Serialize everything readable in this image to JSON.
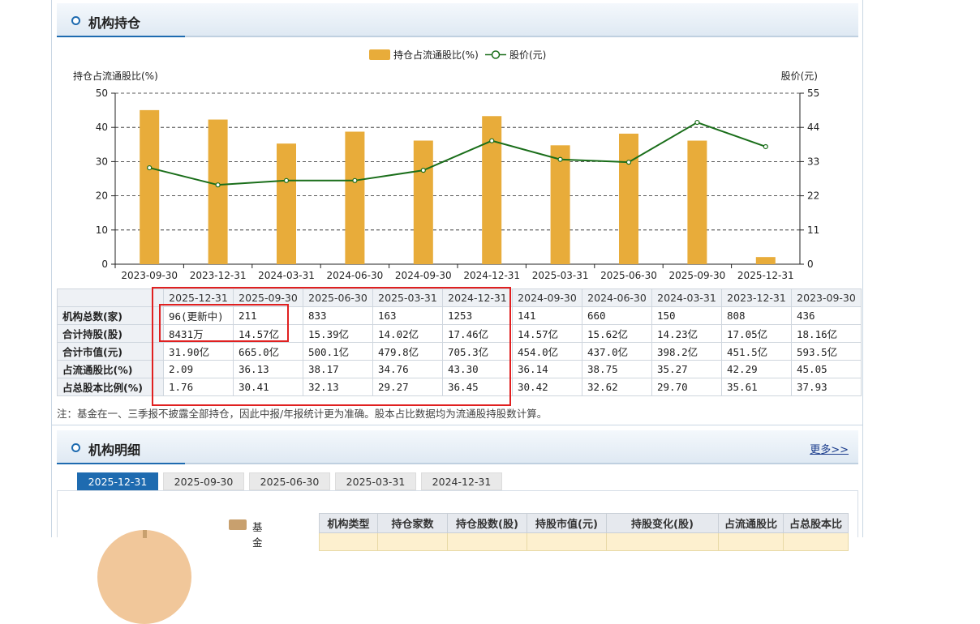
{
  "section1": {
    "title": "机构持仓"
  },
  "chart_data": {
    "type": "bar",
    "categories": [
      "2023-09-30",
      "2023-12-31",
      "2024-03-31",
      "2024-06-30",
      "2024-09-30",
      "2024-12-31",
      "2025-03-31",
      "2025-06-30",
      "2025-09-30",
      "2025-12-31"
    ],
    "series": [
      {
        "name": "持仓占流通股比(%)",
        "type": "bar",
        "axis": "left",
        "values": [
          45.05,
          42.29,
          35.27,
          38.75,
          36.14,
          43.3,
          34.76,
          38.17,
          36.13,
          2.09
        ]
      },
      {
        "name": "股价(元)",
        "type": "line",
        "axis": "right",
        "values": [
          31,
          25.5,
          26.9,
          26.9,
          30.2,
          39.7,
          33.7,
          32.8,
          45.6,
          37.8
        ]
      }
    ],
    "ylabel": "持仓占流通股比(%)",
    "y2label": "股价(元)",
    "ylim": [
      0,
      50
    ],
    "y2lim": [
      0,
      55
    ],
    "yticks": [
      "0",
      "10",
      "20",
      "30",
      "40",
      "50"
    ],
    "y2ticks": [
      "0",
      "11",
      "22",
      "33",
      "44",
      "55"
    ],
    "grid": true,
    "legend_position": "top-center",
    "colors": {
      "bar": "#e8ac3a",
      "line": "#1a6e1a"
    }
  },
  "holdings_table": {
    "columns": [
      "2025-12-31",
      "2025-09-30",
      "2025-06-30",
      "2025-03-31",
      "2024-12-31",
      "2024-09-30",
      "2024-06-30",
      "2024-03-31",
      "2023-12-31",
      "2023-09-30"
    ],
    "rows": [
      {
        "label": "机构总数(家)",
        "values": [
          "96(更新中)",
          "211",
          "833",
          "163",
          "1253",
          "141",
          "660",
          "150",
          "808",
          "436"
        ]
      },
      {
        "label": "合计持股(股)",
        "values": [
          "8431万",
          "14.57亿",
          "15.39亿",
          "14.02亿",
          "17.46亿",
          "14.57亿",
          "15.62亿",
          "14.23亿",
          "17.05亿",
          "18.16亿"
        ]
      },
      {
        "label": "合计市值(元)",
        "values": [
          "31.90亿",
          "665.0亿",
          "500.1亿",
          "479.8亿",
          "705.3亿",
          "454.0亿",
          "437.0亿",
          "398.2亿",
          "451.5亿",
          "593.5亿"
        ]
      },
      {
        "label": "占流通股比(%)",
        "values": [
          "2.09",
          "36.13",
          "38.17",
          "34.76",
          "43.30",
          "36.14",
          "38.75",
          "35.27",
          "42.29",
          "45.05"
        ]
      },
      {
        "label": "占总股本比例(%)",
        "values": [
          "1.76",
          "30.41",
          "32.13",
          "29.27",
          "36.45",
          "30.42",
          "32.62",
          "29.70",
          "35.61",
          "37.93"
        ]
      }
    ]
  },
  "note": "注：基金在一、三季报不披露全部持仓，因此中报/年报统计更为准确。股本占比数据均为流通股持股数计算。",
  "section2": {
    "title": "机构明细",
    "more_link": "更多>>"
  },
  "detail_tabs": [
    "2025-12-31",
    "2025-09-30",
    "2025-06-30",
    "2025-03-31",
    "2024-12-31"
  ],
  "pie_legend": {
    "label": "基金",
    "color": "#c8a06e"
  },
  "detail_table": {
    "headers": [
      "机构类型",
      "持仓家数",
      "持仓股数(股)",
      "持股市值(元)",
      "持股变化(股)",
      "占流通股比",
      "占总股本比"
    ]
  }
}
